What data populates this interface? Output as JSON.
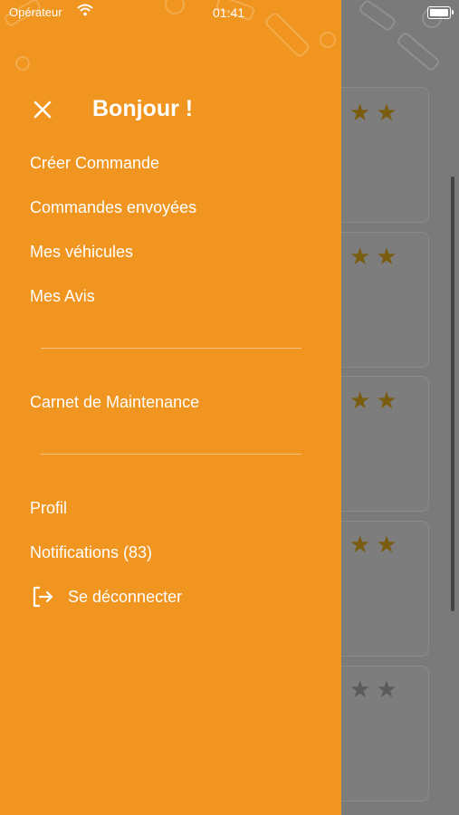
{
  "status_bar": {
    "carrier": "Opérateur",
    "time": "01:41"
  },
  "drawer": {
    "greeting": "Bonjour !",
    "menu": [
      {
        "label": "Créer Commande"
      },
      {
        "label": "Commandes envoyées"
      },
      {
        "label": "Mes véhicules"
      },
      {
        "label": "Mes Avis"
      }
    ],
    "maintenance": {
      "label": "Carnet de Maintenance"
    },
    "account": [
      {
        "label": "Profil"
      },
      {
        "label": "Notifications (83)"
      }
    ],
    "logout": {
      "label": "Se déconnecter",
      "icon": "logout-icon"
    }
  },
  "background_cards": [
    {
      "rating_stars": 2
    },
    {
      "rating_stars": 2
    },
    {
      "rating_stars": 2
    },
    {
      "rating_stars": 2
    },
    {
      "rating_stars": 0
    }
  ],
  "colors": {
    "drawer_bg": "#f0951f",
    "star_gold_dimmed": "#7a5c0f",
    "star_empty_dimmed": "#5a5a5a"
  }
}
